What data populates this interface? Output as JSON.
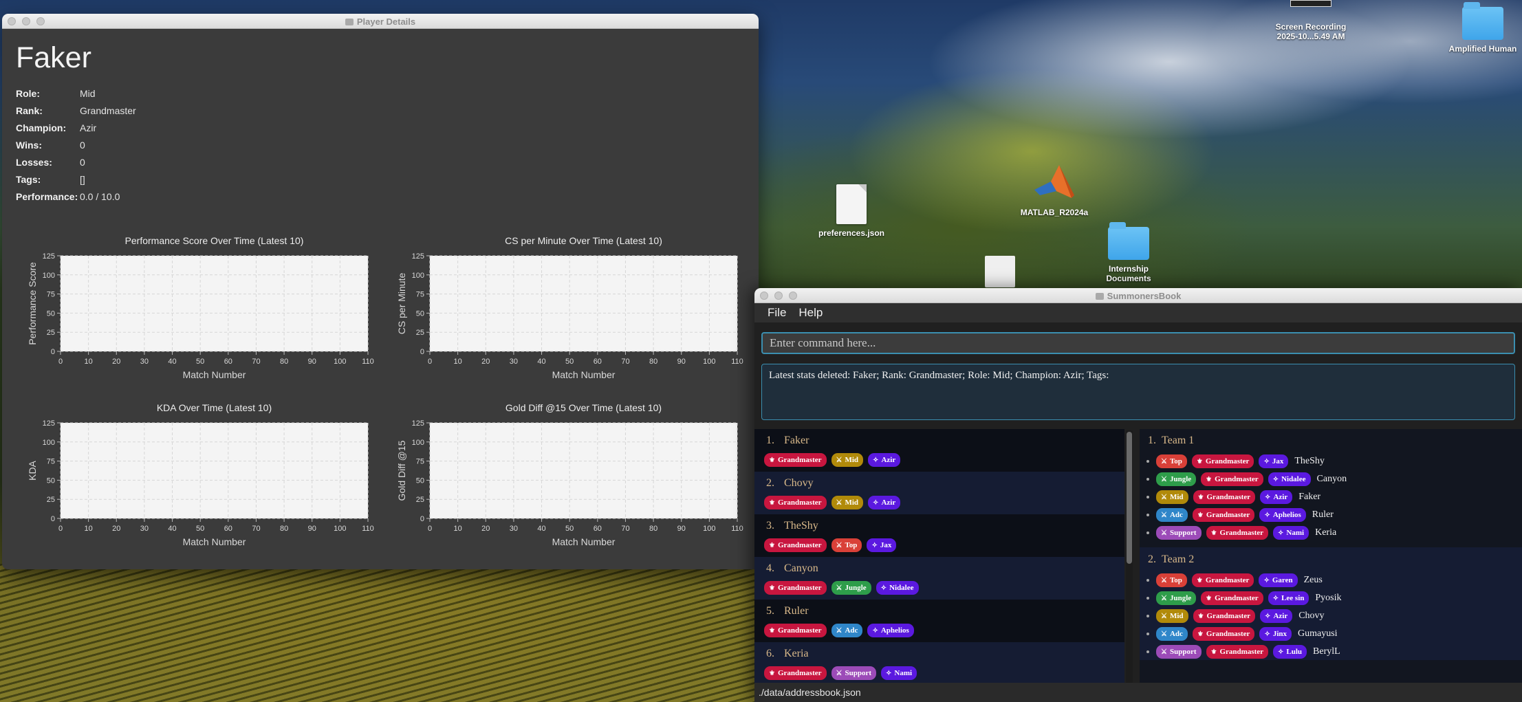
{
  "desktop": {
    "icons": [
      {
        "label": "Screen Recording\n2025-10...5.49 AM",
        "kind": "video"
      },
      {
        "label": "Amplified Human",
        "kind": "folder"
      },
      {
        "label": "preferences.json",
        "kind": "document"
      },
      {
        "label": "MATLAB_R2024a",
        "kind": "app"
      },
      {
        "label": "Internship\nDocuments",
        "kind": "folder"
      }
    ]
  },
  "player_details": {
    "window_title": "Player Details",
    "name": "Faker",
    "fields": [
      {
        "label": "Role:",
        "value": "Mid"
      },
      {
        "label": "Rank:",
        "value": "Grandmaster"
      },
      {
        "label": "Champion:",
        "value": "Azir"
      },
      {
        "label": "Wins:",
        "value": "0"
      },
      {
        "label": "Losses:",
        "value": "0"
      },
      {
        "label": "Tags:",
        "value": "[]"
      },
      {
        "label": "Performance:",
        "value": "0.0 / 10.0"
      }
    ]
  },
  "chart_data": [
    {
      "type": "line",
      "title": "Performance Score Over Time (Latest 10)",
      "xlabel": "Match Number",
      "ylabel": "Performance Score",
      "xlim": [
        0,
        110
      ],
      "ylim": [
        0,
        125
      ],
      "xticks": [
        "0",
        "10",
        "20",
        "30",
        "40",
        "50",
        "60",
        "70",
        "80",
        "90",
        "100",
        "110"
      ],
      "yticks": [
        "0",
        "25",
        "50",
        "75",
        "100",
        "125"
      ],
      "grid": true,
      "series": []
    },
    {
      "type": "line",
      "title": "CS per Minute Over Time (Latest 10)",
      "xlabel": "Match Number",
      "ylabel": "CS per Minute",
      "xlim": [
        0,
        110
      ],
      "ylim": [
        0,
        125
      ],
      "xticks": [
        "0",
        "10",
        "20",
        "30",
        "40",
        "50",
        "60",
        "70",
        "80",
        "90",
        "100",
        "110"
      ],
      "yticks": [
        "0",
        "25",
        "50",
        "75",
        "100",
        "125"
      ],
      "grid": true,
      "series": []
    },
    {
      "type": "line",
      "title": "KDA Over Time (Latest 10)",
      "xlabel": "Match Number",
      "ylabel": "KDA",
      "xlim": [
        0,
        110
      ],
      "ylim": [
        0,
        125
      ],
      "xticks": [
        "0",
        "10",
        "20",
        "30",
        "40",
        "50",
        "60",
        "70",
        "80",
        "90",
        "100",
        "110"
      ],
      "yticks": [
        "0",
        "25",
        "50",
        "75",
        "100",
        "125"
      ],
      "grid": true,
      "series": []
    },
    {
      "type": "line",
      "title": "Gold Diff @15 Over Time (Latest 10)",
      "xlabel": "Match Number",
      "ylabel": "Gold Diff @15",
      "xlim": [
        0,
        110
      ],
      "ylim": [
        0,
        125
      ],
      "xticks": [
        "0",
        "10",
        "20",
        "30",
        "40",
        "50",
        "60",
        "70",
        "80",
        "90",
        "100",
        "110"
      ],
      "yticks": [
        "0",
        "25",
        "50",
        "75",
        "100",
        "125"
      ],
      "grid": true,
      "series": []
    }
  ],
  "summonersbook": {
    "window_title": "SummonersBook",
    "menu": [
      "File",
      "Help"
    ],
    "command_placeholder": "Enter command here...",
    "result_text": "Latest stats deleted: Faker; Rank: Grandmaster; Role: Mid; Champion: Azir; Tags:",
    "status_bar": "./data/addressbook.json",
    "players": [
      {
        "index": "1.",
        "name": "Faker",
        "tags": [
          {
            "text": "Grandmaster",
            "kind": "rank"
          },
          {
            "text": "Mid",
            "kind": "mid"
          },
          {
            "text": "Azir",
            "kind": "champ"
          }
        ]
      },
      {
        "index": "2.",
        "name": "Chovy",
        "tags": [
          {
            "text": "Grandmaster",
            "kind": "rank"
          },
          {
            "text": "Mid",
            "kind": "mid"
          },
          {
            "text": "Azir",
            "kind": "champ"
          }
        ]
      },
      {
        "index": "3.",
        "name": "TheShy",
        "tags": [
          {
            "text": "Grandmaster",
            "kind": "rank"
          },
          {
            "text": "Top",
            "kind": "top"
          },
          {
            "text": "Jax",
            "kind": "champ"
          }
        ]
      },
      {
        "index": "4.",
        "name": "Canyon",
        "tags": [
          {
            "text": "Grandmaster",
            "kind": "rank"
          },
          {
            "text": "Jungle",
            "kind": "jungle"
          },
          {
            "text": "Nidalee",
            "kind": "champ"
          }
        ]
      },
      {
        "index": "5.",
        "name": "Ruler",
        "tags": [
          {
            "text": "Grandmaster",
            "kind": "rank"
          },
          {
            "text": "Adc",
            "kind": "adc"
          },
          {
            "text": "Aphelios",
            "kind": "champ"
          }
        ]
      },
      {
        "index": "6.",
        "name": "Keria",
        "tags": [
          {
            "text": "Grandmaster",
            "kind": "rank"
          },
          {
            "text": "Support",
            "kind": "support"
          },
          {
            "text": "Nami",
            "kind": "champ"
          }
        ]
      }
    ],
    "teams": [
      {
        "index": "1.",
        "name": "Team 1",
        "members": [
          {
            "role": "Top",
            "kind": "top",
            "rank": "Grandmaster",
            "champ": "Jax",
            "player": "TheShy"
          },
          {
            "role": "Jungle",
            "kind": "jungle",
            "rank": "Grandmaster",
            "champ": "Nidalee",
            "player": "Canyon"
          },
          {
            "role": "Mid",
            "kind": "mid",
            "rank": "Grandmaster",
            "champ": "Azir",
            "player": "Faker"
          },
          {
            "role": "Adc",
            "kind": "adc",
            "rank": "Grandmaster",
            "champ": "Aphelios",
            "player": "Ruler"
          },
          {
            "role": "Support",
            "kind": "support",
            "rank": "Grandmaster",
            "champ": "Nami",
            "player": "Keria"
          }
        ]
      },
      {
        "index": "2.",
        "name": "Team 2",
        "members": [
          {
            "role": "Top",
            "kind": "top",
            "rank": "Grandmaster",
            "champ": "Garen",
            "player": "Zeus"
          },
          {
            "role": "Jungle",
            "kind": "jungle",
            "rank": "Grandmaster",
            "champ": "Lee sin",
            "player": "Pyosik"
          },
          {
            "role": "Mid",
            "kind": "mid",
            "rank": "Grandmaster",
            "champ": "Azir",
            "player": "Chovy"
          },
          {
            "role": "Adc",
            "kind": "adc",
            "rank": "Grandmaster",
            "champ": "Jinx",
            "player": "Gumayusi"
          },
          {
            "role": "Support",
            "kind": "support",
            "rank": "Grandmaster",
            "champ": "Lulu",
            "player": "BerylL"
          }
        ]
      }
    ]
  },
  "colors": {
    "rank": "#c8163f",
    "mid": "#b18a0a",
    "top": "#d94038",
    "jungle": "#2e9d4a",
    "adc": "#2f86c9",
    "support": "#9c4bb8",
    "champ": "#5b19e0",
    "accent": "#3b8fb0",
    "name": "#d9b98a"
  },
  "icons": {
    "rank": "fleur-icon",
    "role": "crossed-swords-icon",
    "champ": "diamond-icon"
  }
}
